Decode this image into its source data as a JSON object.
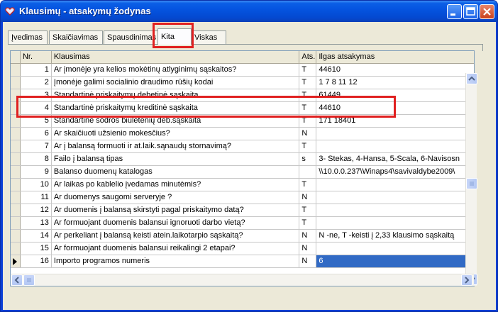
{
  "window": {
    "title": "Klausimų - atsakymų žodynas",
    "icon": "app-heart-icon"
  },
  "tabs": [
    {
      "label": "Įvedimas",
      "active": false
    },
    {
      "label": "Skaičiavimas",
      "active": false
    },
    {
      "label": "Spausdinimas",
      "active": false
    },
    {
      "label": "Kita",
      "active": true
    },
    {
      "label": "Viskas",
      "active": false
    }
  ],
  "grid": {
    "columns": [
      "Nr.",
      "Klausimas",
      "Ats.",
      "Ilgas atsakymas"
    ],
    "rows": [
      {
        "nr": "1",
        "q": "Ar įmonėje yra kelios mokėtinų atlyginimų sąskaitos?",
        "ats": "T",
        "ilg": "44610"
      },
      {
        "nr": "2",
        "q": "Įmonėje galimi socialinio draudimo rūšių kodai",
        "ats": "T",
        "ilg": "1 7 8 11 12"
      },
      {
        "nr": "3",
        "q": "Standartinė priskaitymų debetinė sąskaita",
        "ats": "T",
        "ilg": "61449"
      },
      {
        "nr": "4",
        "q": "Standartinė priskaitymų kreditinė sąskaita",
        "ats": "T",
        "ilg": "44610"
      },
      {
        "nr": "5",
        "q": "Standartinė sodros biuletenių deb.sąskaita",
        "ats": "T",
        "ilg": "171 18401"
      },
      {
        "nr": "6",
        "q": "Ar skaičiuoti užsienio mokesčius?",
        "ats": "N",
        "ilg": ""
      },
      {
        "nr": "7",
        "q": "Ar į balansą formuoti ir at.laik.sąnaudų stornavimą?",
        "ats": "T",
        "ilg": ""
      },
      {
        "nr": "8",
        "q": "Failo į balansą tipas",
        "ats": "s",
        "ilg": "3- Stekas, 4-Hansa, 5-Scala, 6-Navisosn"
      },
      {
        "nr": "9",
        "q": "Balanso duomenų katalogas",
        "ats": "",
        "ilg": "\\\\10.0.0.237\\Winaps4\\savivaldybe2009\\"
      },
      {
        "nr": "10",
        "q": "Ar laikas po kablelio įvedamas minutėmis?",
        "ats": "T",
        "ilg": ""
      },
      {
        "nr": "11",
        "q": "Ar duomenys saugomi serveryje ?",
        "ats": "N",
        "ilg": ""
      },
      {
        "nr": "12",
        "q": "Ar duomenis į balansą skirstyti pagal priskaitymo datą?",
        "ats": "T",
        "ilg": ""
      },
      {
        "nr": "13",
        "q": "Ar formuojant duomenis balansui ignoruoti darbo vietą?",
        "ats": "T",
        "ilg": ""
      },
      {
        "nr": "14",
        "q": "Ar perkeliant į balansą keisti atein.laikotarpio sąskaitą?",
        "ats": "N",
        "ilg": "N -ne, T -keisti į 2,33 klausimo sąskaitą"
      },
      {
        "nr": "15",
        "q": "Ar formuojant duomenis balansui reikalingi 2 etapai?",
        "ats": "N",
        "ilg": ""
      },
      {
        "nr": "16",
        "q": "Importo programos numeris",
        "ats": "N",
        "ilg": "6"
      }
    ]
  },
  "colors": {
    "highlight": "#e02020",
    "selection": "#316ac5"
  }
}
